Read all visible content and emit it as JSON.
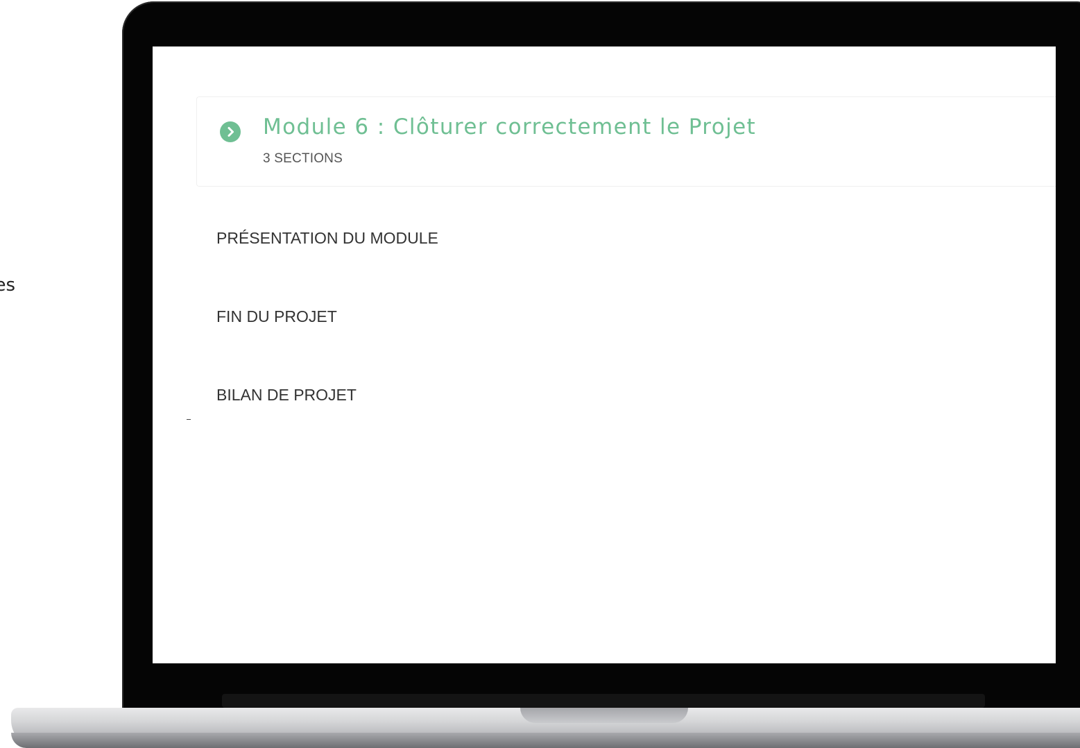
{
  "background_fragment": "es",
  "module": {
    "title": "Module 6 : Clôturer correctement le Projet",
    "section_count": "3 SECTIONS",
    "accent_color": "#6fbf93",
    "icon": "play-circle-icon"
  },
  "sections": [
    {
      "label": "PRÉSENTATION DU MODULE"
    },
    {
      "label": "FIN DU PROJET"
    },
    {
      "label": "BILAN DE PROJET"
    }
  ]
}
